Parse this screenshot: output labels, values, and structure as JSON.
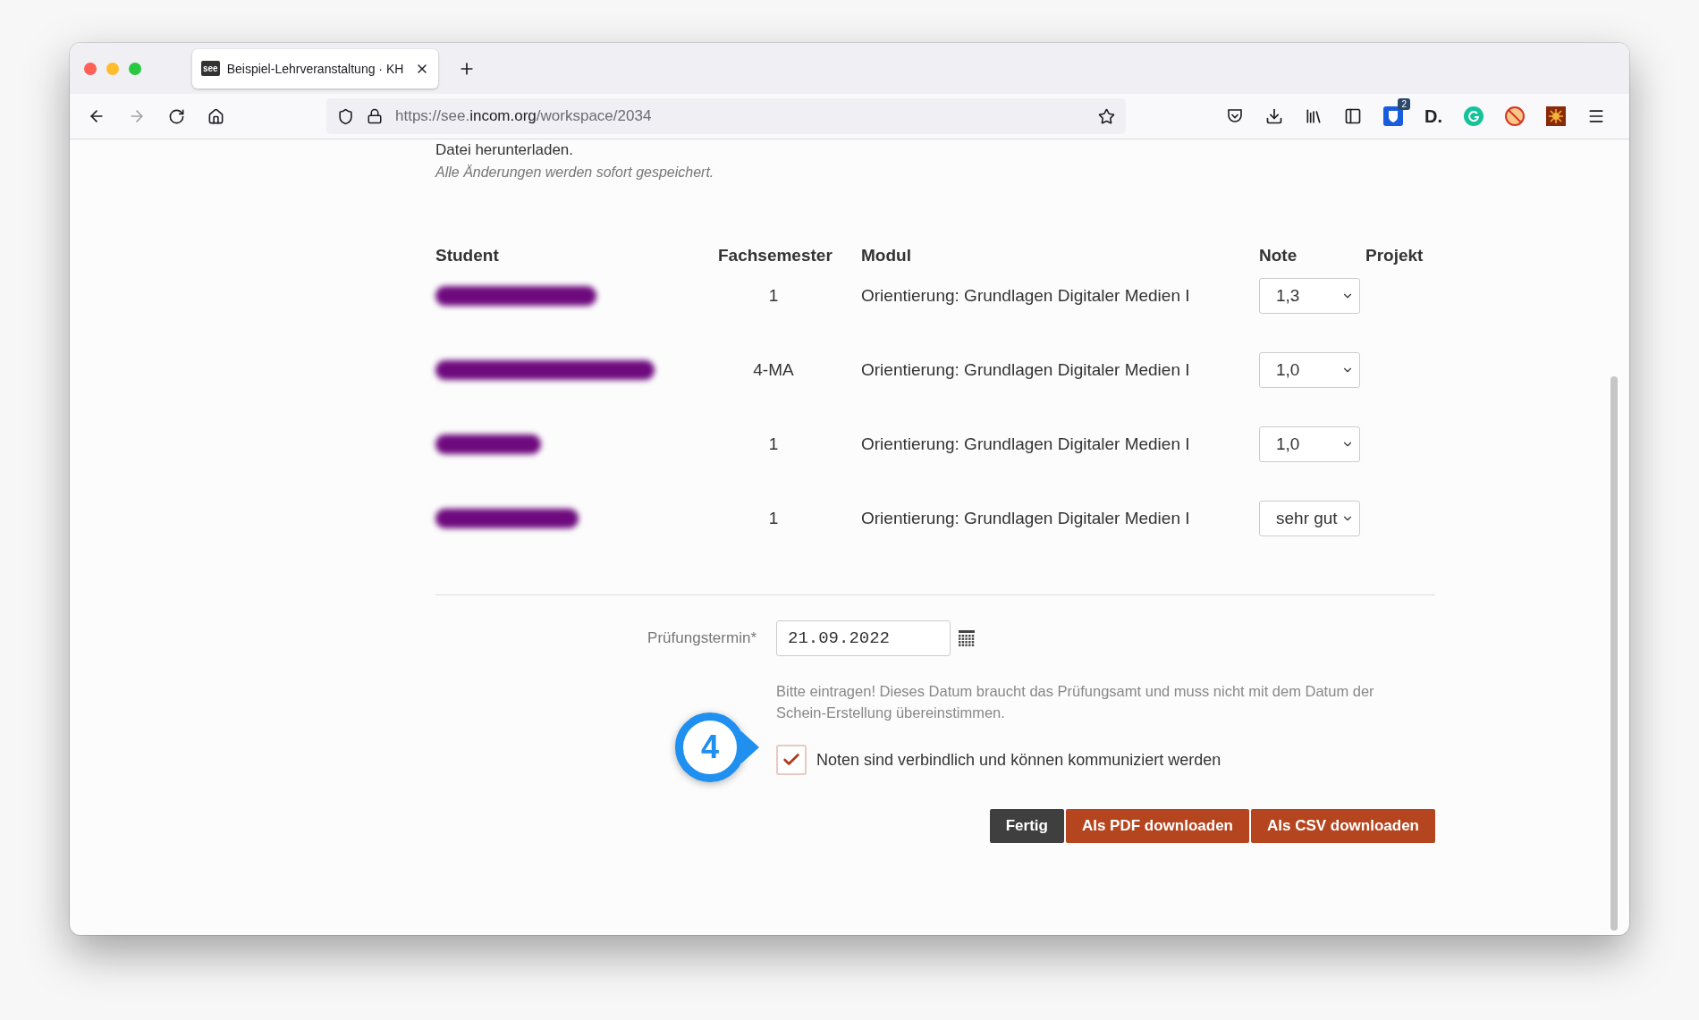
{
  "browser": {
    "tab": {
      "favicon_text": "see",
      "title": "Beispiel-Lehrveranstaltung · KH"
    },
    "url": {
      "scheme": "https://see.",
      "host": "incom.org",
      "path": "/workspace/2034"
    },
    "extensions": [
      {
        "kind": "bitwarden",
        "badge": "2"
      },
      {
        "kind": "letter",
        "label": "D."
      },
      {
        "kind": "grammarly"
      },
      {
        "kind": "blocked"
      },
      {
        "kind": "sun"
      }
    ]
  },
  "page": {
    "clipped_heading": "Datei herunterladen.",
    "note": "Alle Änderungen werden sofort gespeichert.",
    "table": {
      "columns": [
        "Student",
        "Fachsemester",
        "Modul",
        "Note",
        "Projekt"
      ],
      "rows": [
        {
          "student": {
            "kind": "redacted"
          },
          "semester": "1",
          "module": "Orientierung: Grundlagen Digitaler Medien I",
          "grade": "1,3"
        },
        {
          "student": {
            "kind": "redacted"
          },
          "semester": "4-MA",
          "module": "Orientierung: Grundlagen Digitaler Medien I",
          "grade": "1,0"
        },
        {
          "student": {
            "kind": "redacted"
          },
          "semester": "1",
          "module": "Orientierung: Grundlagen Digitaler Medien I",
          "grade": "1,0"
        },
        {
          "student": {
            "kind": "redacted"
          },
          "semester": "1",
          "module": "Orientierung: Grundlagen Digitaler Medien I",
          "grade": "sehr gut"
        }
      ]
    },
    "date": {
      "label": "Prüfungstermin*",
      "value": "21.09.2022"
    },
    "help": "Bitte eintragen! Dieses Datum braucht das Prüfungsamt und muss nicht mit dem Datum der Schein-Erstellung übereinstimmen.",
    "callout": "4",
    "confirm": {
      "label": "Noten sind verbindlich und können kommuniziert werden",
      "checked": true
    },
    "buttons": [
      {
        "label": "Fertig",
        "kind": "dark"
      },
      {
        "label": "Als PDF downloaden",
        "kind": "accent"
      },
      {
        "label": "Als CSV downloaden",
        "kind": "accent"
      }
    ]
  }
}
